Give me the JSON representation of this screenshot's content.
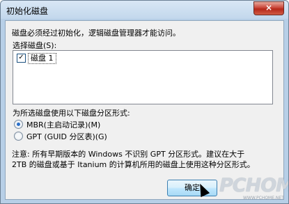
{
  "window": {
    "title": "初始化磁盘",
    "close_glyph": "×"
  },
  "intro": "磁盘必须经过初始化，逻辑磁盘管理器才能访问。",
  "select_label": "选择磁盘(S):",
  "disks": [
    {
      "label": "磁盘 1",
      "checked": true
    }
  ],
  "partition_label": "为所选磁盘使用以下磁盘分区形式:",
  "options": [
    {
      "label": "MBR(主启动记录)(M)",
      "selected": true
    },
    {
      "label": "GPT (GUID 分区表)(G)",
      "selected": false
    }
  ],
  "note_line1": "注意: 所有早期版本的 Windows 不识别 GPT 分区形式。建议在大于",
  "note_line2": "2TB 的磁盘或基于 Itanium 的计算机所用的磁盘上使用这种分区形式。",
  "buttons": {
    "ok": "确定"
  },
  "watermark": {
    "brand": "PCHOME",
    "url": "WWW.PCHOME.NET"
  },
  "colors": {
    "accent": "#2a6fc9",
    "close_red": "#c9473a"
  }
}
